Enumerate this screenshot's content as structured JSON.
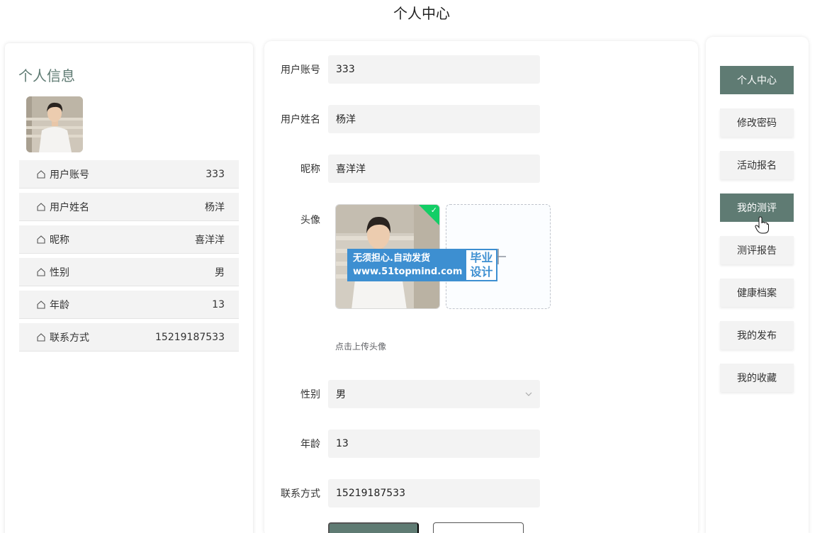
{
  "page": {
    "title": "个人中心"
  },
  "left": {
    "title": "个人信息",
    "rows": [
      {
        "label": "用户账号",
        "value": "333"
      },
      {
        "label": "用户姓名",
        "value": "杨洋"
      },
      {
        "label": "昵称",
        "value": "喜洋洋"
      },
      {
        "label": "性别",
        "value": "男"
      },
      {
        "label": "年龄",
        "value": "13"
      },
      {
        "label": "联系方式",
        "value": "15219187533"
      }
    ]
  },
  "form": {
    "account": {
      "label": "用户账号",
      "value": "333"
    },
    "name": {
      "label": "用户姓名",
      "value": "杨洋"
    },
    "nickname": {
      "label": "昵称",
      "value": "喜洋洋"
    },
    "avatar": {
      "label": "头像",
      "tip": "点击上传头像"
    },
    "gender": {
      "label": "性别",
      "value": "男"
    },
    "age": {
      "label": "年龄",
      "value": "13"
    },
    "phone": {
      "label": "联系方式",
      "value": "15219187533"
    },
    "watermark": {
      "line1": "无须担心.自动发货",
      "line2": "www.51topmind.com",
      "side1": "毕业",
      "side2": "设计"
    }
  },
  "menu": {
    "items": [
      {
        "label": "个人中心",
        "active": true
      },
      {
        "label": "修改密码",
        "active": false
      },
      {
        "label": "活动报名",
        "active": false
      },
      {
        "label": "我的测评",
        "active": true
      },
      {
        "label": "测评报告",
        "active": false
      },
      {
        "label": "健康档案",
        "active": false
      },
      {
        "label": "我的发布",
        "active": false
      },
      {
        "label": "我的收藏",
        "active": false
      }
    ]
  },
  "colors": {
    "accent": "#5f7b73",
    "success": "#13ce66",
    "watermark": "#3d8fd1"
  }
}
